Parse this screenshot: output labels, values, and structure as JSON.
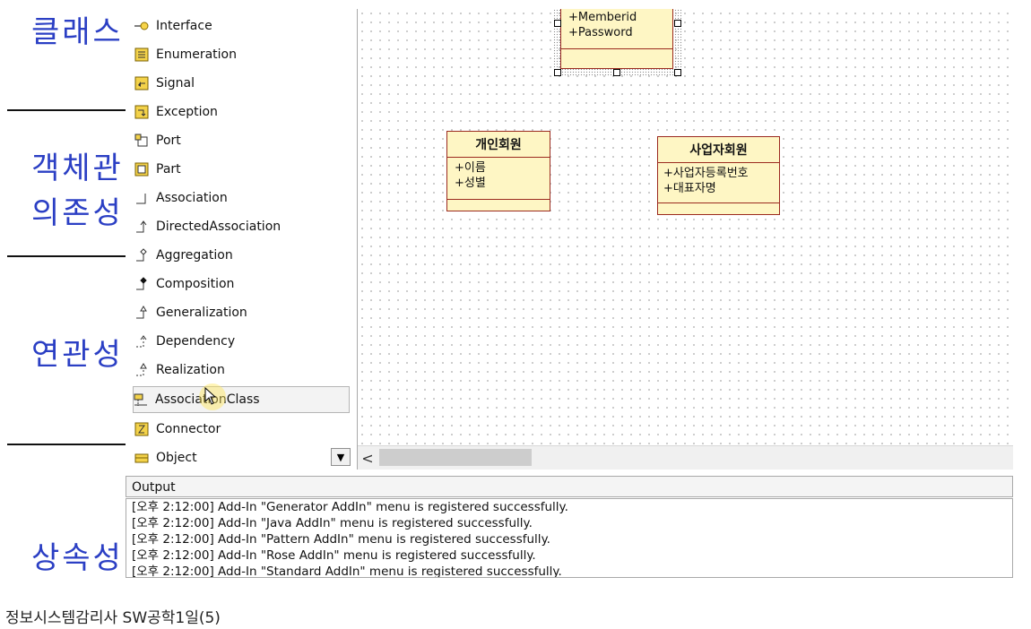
{
  "slide": {
    "headings": [
      "클래스",
      "객체관",
      "의존성",
      "연관성",
      "상속성"
    ]
  },
  "toolbox": {
    "items": [
      {
        "label": "Interface",
        "icon": "interface-icon"
      },
      {
        "label": "Enumeration",
        "icon": "enumeration-icon"
      },
      {
        "label": "Signal",
        "icon": "signal-icon"
      },
      {
        "label": "Exception",
        "icon": "exception-icon"
      },
      {
        "label": "Port",
        "icon": "port-icon"
      },
      {
        "label": "Part",
        "icon": "part-icon"
      },
      {
        "label": "Association",
        "icon": "association-icon"
      },
      {
        "label": "DirectedAssociation",
        "icon": "directed-association-icon"
      },
      {
        "label": "Aggregation",
        "icon": "aggregation-icon"
      },
      {
        "label": "Composition",
        "icon": "composition-icon"
      },
      {
        "label": "Generalization",
        "icon": "generalization-icon"
      },
      {
        "label": "Dependency",
        "icon": "dependency-icon"
      },
      {
        "label": "Realization",
        "icon": "realization-icon"
      },
      {
        "label": "AssociationClass",
        "icon": "association-class-icon",
        "selected": true
      },
      {
        "label": "Connector",
        "icon": "connector-icon"
      },
      {
        "label": "Object",
        "icon": "object-icon"
      }
    ],
    "dropdown_glyph": "▼"
  },
  "canvas": {
    "member_class": {
      "attrs": [
        "+Memberid",
        "+Password"
      ]
    },
    "personal_class": {
      "name": "개인회원",
      "attrs": [
        "+이름",
        "+성별"
      ]
    },
    "business_class": {
      "name": "사업자회원",
      "attrs": [
        "+사업자등록번호",
        "+대표자명"
      ]
    }
  },
  "hscroll": {
    "left_arrow": "<"
  },
  "output": {
    "title": "Output",
    "lines": [
      "[오후 2:12:00]  Add-In \"Generator AddIn\" menu is registered successfully.",
      "[오후 2:12:00]  Add-In \"Java AddIn\" menu is registered successfully.",
      "[오후 2:12:00]  Add-In \"Pattern AddIn\" menu is registered successfully.",
      "[오후 2:12:00]  Add-In \"Rose AddIn\" menu is registered successfully.",
      "[오후 2:12:00]  Add-In \"Standard AddIn\" menu is registered successfully."
    ]
  },
  "caption": "정보시스템감리사 SW공학1일(5)",
  "colors": {
    "uml_fill": "#fef6c4",
    "uml_border": "#9b2a1f",
    "heading": "#2b3fc4"
  }
}
